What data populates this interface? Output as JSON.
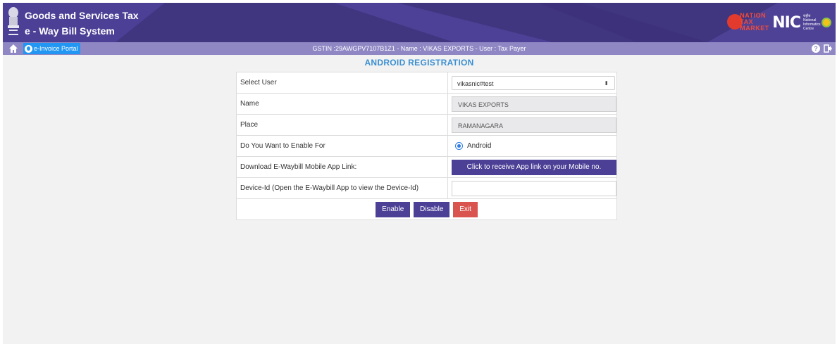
{
  "header": {
    "title_line1": "Goods and Services Tax",
    "title_line2": "e - Way Bill System",
    "partner_logo_text": [
      "NATION",
      "TAX",
      "MARKET"
    ],
    "nic_text": "NIC",
    "nic_subtext": "राष्ट्रीय National Informatics Centre"
  },
  "navbar": {
    "portal_label": "e-Invoice Portal",
    "info": "GSTIN :29AWGPV7107B1Z1 - Name : VIKAS EXPORTS - User : Tax Payer"
  },
  "page": {
    "title": "ANDROID REGISTRATION"
  },
  "form": {
    "select_user_label": "Select User",
    "select_user_value": "vikasnic#test",
    "name_label": "Name",
    "name_value": "VIKAS EXPORTS",
    "place_label": "Place",
    "place_value": "RAMANAGARA",
    "enable_for_label": "Do You Want to Enable For",
    "enable_for_option": "Android",
    "download_label": "Download E-Waybill Mobile App Link:",
    "download_button": "Click to receive App link on your Mobile no.",
    "device_id_label": "Device-Id (Open the E-Waybill App to view the Device-Id)",
    "device_id_value": ""
  },
  "actions": {
    "enable": "Enable",
    "disable": "Disable",
    "exit": "Exit"
  },
  "colors": {
    "header_bg": "#4b3f96",
    "navbar_bg": "#8e87c4",
    "title_color": "#3a8fd1",
    "exit_button": "#d9534f",
    "portal_button": "#2196f3"
  },
  "icons": [
    "emblem-icon",
    "home-icon",
    "globe-icon",
    "help-icon",
    "logout-icon",
    "caret-icon"
  ]
}
